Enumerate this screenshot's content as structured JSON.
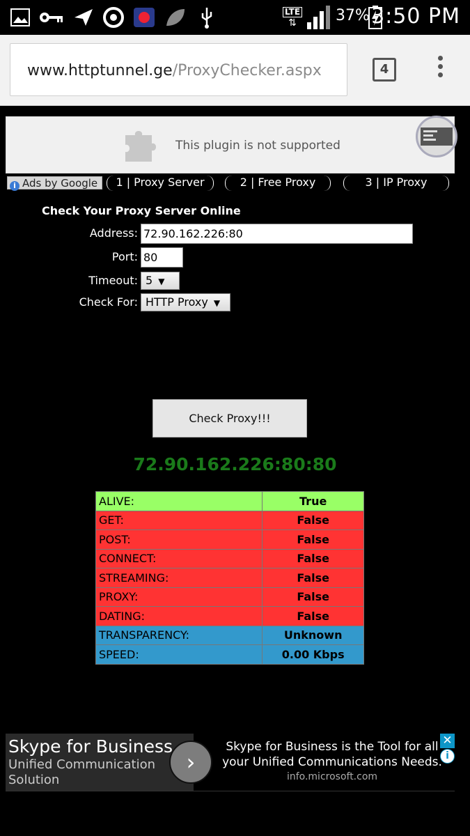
{
  "status_bar": {
    "time": "3:50 PM",
    "battery_percent": "37%",
    "network": "LTE"
  },
  "browser": {
    "url_domain": "www.httptunnel.ge",
    "url_path": "/ProxyChecker.aspx",
    "tab_count": "4"
  },
  "plugin": {
    "message": "This plugin is not supported"
  },
  "nav": {
    "ads_label": "Ads by Google",
    "links": [
      {
        "label": "1 | Proxy Server"
      },
      {
        "label": "2 | Free Proxy"
      },
      {
        "label": "3 | IP Proxy"
      }
    ]
  },
  "form": {
    "title": "Check Your Proxy Server Online",
    "address_label": "Address:",
    "address_value": "72.90.162.226:80",
    "port_label": "Port:",
    "port_value": "80",
    "timeout_label": "Timeout:",
    "timeout_value": "5",
    "check_for_label": "Check For:",
    "check_for_value": "HTTP Proxy",
    "check_button": "Check Proxy!!!"
  },
  "result": {
    "address": "72.90.162.226:80:80",
    "rows": [
      {
        "key": "ALIVE:",
        "value": "True",
        "color": "#99ff66"
      },
      {
        "key": "GET:",
        "value": "False",
        "color": "#ff3333"
      },
      {
        "key": "POST:",
        "value": "False",
        "color": "#ff3333"
      },
      {
        "key": "CONNECT:",
        "value": "False",
        "color": "#ff3333"
      },
      {
        "key": "STREAMING:",
        "value": "False",
        "color": "#ff3333"
      },
      {
        "key": "PROXY:",
        "value": "False",
        "color": "#ff3333"
      },
      {
        "key": "DATING:",
        "value": "False",
        "color": "#ff3333"
      },
      {
        "key": "TRANSPARENCY:",
        "value": "Unknown",
        "color": "#3399cc"
      },
      {
        "key": "SPEED:",
        "value": "0.00 Kbps",
        "color": "#3399cc"
      }
    ]
  },
  "ad": {
    "title": "Skype for Business",
    "subtitle": "Unified Communication Solution",
    "description": "Skype for Business is the Tool for all your Unified Communications Needs.",
    "domain": "info.microsoft.com",
    "close_icon": "close-icon",
    "info_icon": "info-icon"
  }
}
